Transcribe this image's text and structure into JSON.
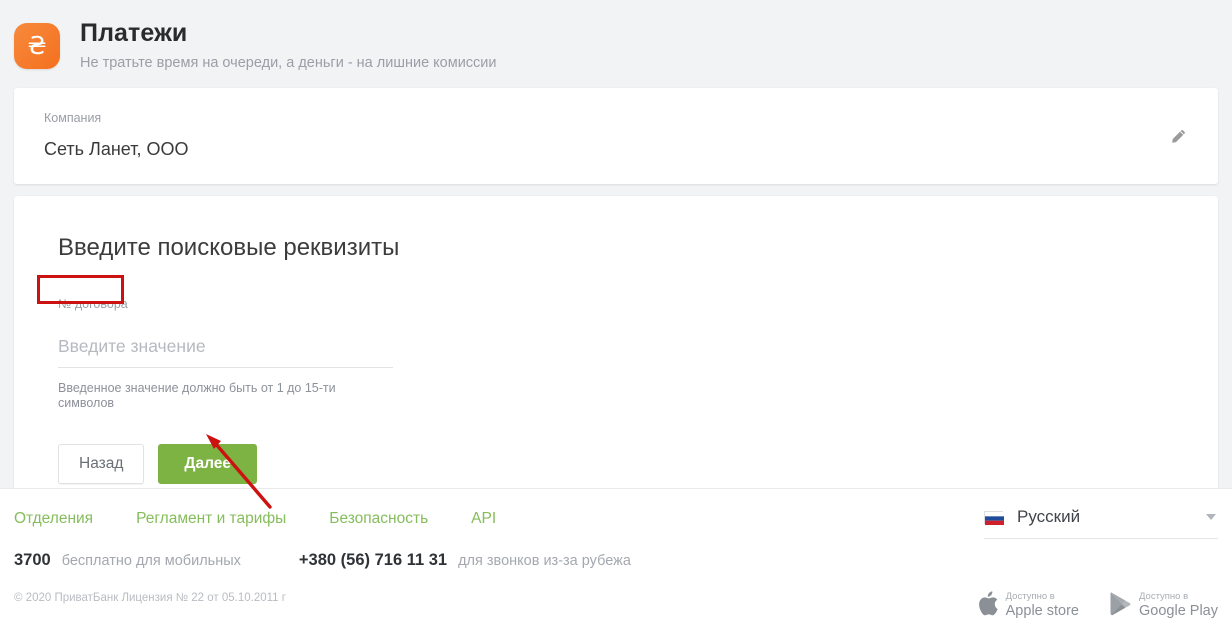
{
  "header": {
    "logo_icon": "hryvnia-currency-icon",
    "logo_glyph": "₴",
    "title": "Платежи",
    "subtitle": "Не тратьте время на очереди, а деньги - на лишние комиссии"
  },
  "company_card": {
    "label": "Компания",
    "value": "Сеть Ланет, ООО",
    "edit_icon": "pencil-edit-icon"
  },
  "search_card": {
    "heading": "Введите поисковые реквизиты",
    "field_label": "№ договора",
    "field_value": "",
    "field_placeholder": "Введите значение",
    "hint": "Введенное значение должно быть от 1 до 15-ти символов",
    "back_button": "Назад",
    "next_button": "Далее"
  },
  "footer": {
    "links": [
      {
        "label": "Отделения"
      },
      {
        "label": "Регламент и тарифы"
      },
      {
        "label": "Безопасность"
      },
      {
        "label": "API"
      }
    ],
    "phones": [
      {
        "number": "3700",
        "description": "бесплатно для мобильных"
      },
      {
        "number": "+380 (56) 716 11 31",
        "description": "для звонков из-за рубежа"
      }
    ],
    "copyright": "© 2020 ПриватБанк Лицензия № 22 от 05.10.2011 г",
    "language": {
      "flag_icon": "russian-flag-icon",
      "name": "Русский",
      "chevron_icon": "chevron-down-icon"
    },
    "stores": [
      {
        "icon": "apple-logo-icon",
        "available": "Доступно в",
        "name": "Apple store"
      },
      {
        "icon": "google-play-icon",
        "available": "Доступно в",
        "name": "Google Play"
      }
    ]
  },
  "annotations": {
    "highlight_box_target": "№ договора",
    "arrow_target": "Далее"
  },
  "colors": {
    "brand_orange": "#f4701f",
    "accent_green": "#7cb342",
    "link_green": "#86bd5c",
    "annotation_red": "#cc1111",
    "page_background": "#f2f3f5"
  }
}
